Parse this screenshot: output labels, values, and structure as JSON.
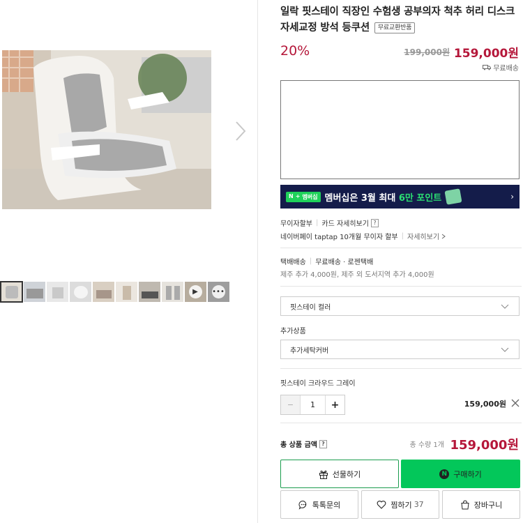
{
  "gallery": {
    "main_image": "office-chair-with-posture-cushion",
    "next_icon": "chevron-right-icon",
    "thumbnails": [
      {
        "type": "image",
        "active": true
      },
      {
        "type": "image",
        "active": false
      },
      {
        "type": "image",
        "active": false
      },
      {
        "type": "image",
        "active": false
      },
      {
        "type": "image",
        "active": false
      },
      {
        "type": "image",
        "active": false
      },
      {
        "type": "image",
        "active": false
      },
      {
        "type": "image",
        "active": false
      },
      {
        "type": "video",
        "active": false
      },
      {
        "type": "more",
        "active": false
      }
    ]
  },
  "product": {
    "title": "일락 핏스테이 직장인 수험생 공부의자 척추 허리 디스크 자세교정 방석 등쿠션",
    "badge": "무료교환반품",
    "discount": "20%",
    "original_price": "199,000원",
    "sale_price": "159,000원",
    "shipping_badge": "무료배송"
  },
  "banner": {
    "badge_n": "N",
    "badge_plus": "+",
    "badge_label": "멤버십",
    "text_prefix": "멤버십은 3월 최대 ",
    "text_highlight": "6만 포인트",
    "arrow": "›"
  },
  "benefits": {
    "installment": "무이자할부",
    "card_detail": "카드 자세히보기",
    "npay_line": "네이버페이 taptap 10개월 무이자 할부",
    "detail_link": "자세히보기",
    "help_mark": "?"
  },
  "delivery": {
    "method": "택배배송",
    "fee": "무료배송 · 로젠택배",
    "extra": "제주 추가 4,000원, 제주 외 도서지역 추가 4,000원"
  },
  "options": {
    "color_select": "핏스테이 컬러",
    "addon_label": "추가상품",
    "addon_select": "추가세탁커버"
  },
  "selected_item": {
    "name": "핏스테이 크라우드 그레이",
    "minus": "−",
    "quantity": "1",
    "plus": "+",
    "price": "159,000원"
  },
  "total": {
    "label": "총 상품 금액",
    "help": "?",
    "count": "총 수량 1개",
    "price": "159,000원"
  },
  "actions": {
    "gift": "선물하기",
    "buy": "구매하기",
    "buy_icon_letter": "N",
    "talk": "톡톡문의",
    "like": "찜하기",
    "like_count": "37",
    "cart": "장바구니"
  },
  "colors": {
    "price_red": "#b5173a",
    "naver_green": "#03c75a",
    "banner_navy": "#141c4a"
  }
}
